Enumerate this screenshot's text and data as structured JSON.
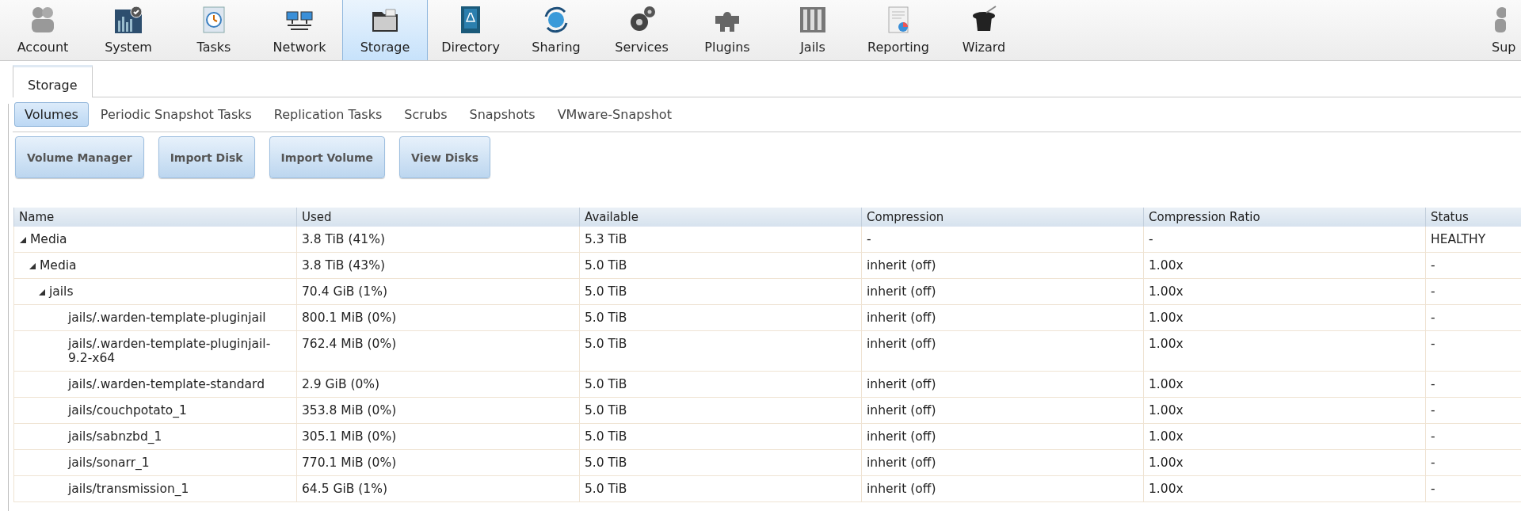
{
  "toolbar": {
    "items": [
      {
        "label": "Account",
        "selected": false
      },
      {
        "label": "System",
        "selected": false
      },
      {
        "label": "Tasks",
        "selected": false
      },
      {
        "label": "Network",
        "selected": false
      },
      {
        "label": "Storage",
        "selected": true
      },
      {
        "label": "Directory",
        "selected": false
      },
      {
        "label": "Sharing",
        "selected": false
      },
      {
        "label": "Services",
        "selected": false
      },
      {
        "label": "Plugins",
        "selected": false
      },
      {
        "label": "Jails",
        "selected": false
      },
      {
        "label": "Reporting",
        "selected": false
      },
      {
        "label": "Wizard",
        "selected": false
      }
    ],
    "right_item": {
      "label": "Sup"
    }
  },
  "tabs": [
    {
      "label": "Storage",
      "selected": true
    }
  ],
  "subtabs": [
    {
      "label": "Volumes",
      "selected": true
    },
    {
      "label": "Periodic Snapshot Tasks",
      "selected": false
    },
    {
      "label": "Replication Tasks",
      "selected": false
    },
    {
      "label": "Scrubs",
      "selected": false
    },
    {
      "label": "Snapshots",
      "selected": false
    },
    {
      "label": "VMware-Snapshot",
      "selected": false
    }
  ],
  "buttons": [
    "Volume Manager",
    "Import Disk",
    "Import Volume",
    "View Disks"
  ],
  "table": {
    "columns": [
      "Name",
      "Used",
      "Available",
      "Compression",
      "Compression Ratio",
      "Status"
    ],
    "rows": [
      {
        "name": "Media",
        "used": "3.8 TiB (41%)",
        "available": "5.3 TiB",
        "compression": "-",
        "ratio": "-",
        "status": "HEALTHY",
        "expanded": true,
        "children": [
          {
            "name": "Media",
            "used": "3.8 TiB (43%)",
            "available": "5.0 TiB",
            "compression": "inherit (off)",
            "ratio": "1.00x",
            "status": "-",
            "expanded": true,
            "children": [
              {
                "name": "jails",
                "used": "70.4 GiB (1%)",
                "available": "5.0 TiB",
                "compression": "inherit (off)",
                "ratio": "1.00x",
                "status": "-",
                "expanded": true,
                "children": [
                  {
                    "name": "jails/.warden-template-pluginjail",
                    "used": "800.1 MiB (0%)",
                    "available": "5.0 TiB",
                    "compression": "inherit (off)",
                    "ratio": "1.00x",
                    "status": "-"
                  },
                  {
                    "name": "jails/.warden-template-pluginjail-9.2-x64",
                    "used": "762.4 MiB (0%)",
                    "available": "5.0 TiB",
                    "compression": "inherit (off)",
                    "ratio": "1.00x",
                    "status": "-"
                  },
                  {
                    "name": "jails/.warden-template-standard",
                    "used": "2.9 GiB (0%)",
                    "available": "5.0 TiB",
                    "compression": "inherit (off)",
                    "ratio": "1.00x",
                    "status": "-"
                  },
                  {
                    "name": "jails/couchpotato_1",
                    "used": "353.8 MiB (0%)",
                    "available": "5.0 TiB",
                    "compression": "inherit (off)",
                    "ratio": "1.00x",
                    "status": "-"
                  },
                  {
                    "name": "jails/sabnzbd_1",
                    "used": "305.1 MiB (0%)",
                    "available": "5.0 TiB",
                    "compression": "inherit (off)",
                    "ratio": "1.00x",
                    "status": "-"
                  },
                  {
                    "name": "jails/sonarr_1",
                    "used": "770.1 MiB (0%)",
                    "available": "5.0 TiB",
                    "compression": "inherit (off)",
                    "ratio": "1.00x",
                    "status": "-"
                  },
                  {
                    "name": "jails/transmission_1",
                    "used": "64.5 GiB (1%)",
                    "available": "5.0 TiB",
                    "compression": "inherit (off)",
                    "ratio": "1.00x",
                    "status": "-"
                  }
                ]
              }
            ]
          }
        ]
      }
    ]
  }
}
